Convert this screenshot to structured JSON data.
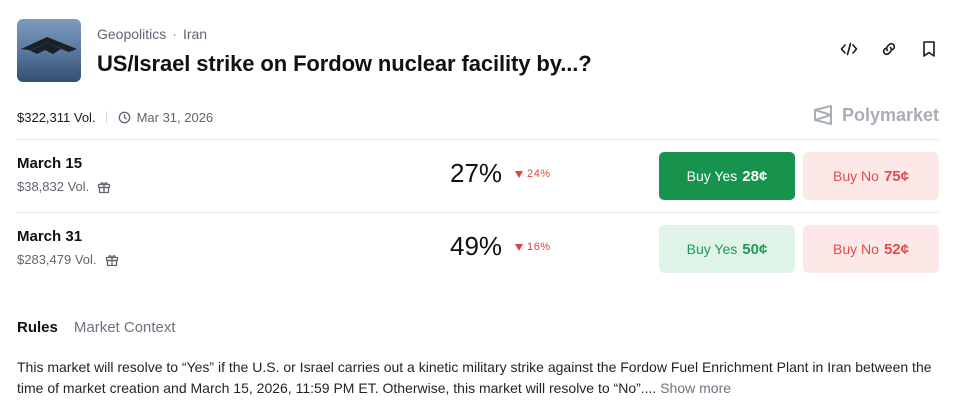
{
  "header": {
    "breadcrumb": [
      "Geopolitics",
      "Iran"
    ],
    "breadcrumb_sep": "·",
    "title": "US/Israel strike on Fordow nuclear facility by...?"
  },
  "meta": {
    "volume": "$322,311 Vol.",
    "end_date": "Mar 31, 2026",
    "brand": "Polymarket"
  },
  "outcomes": [
    {
      "name": "March 15",
      "volume": "$38,832 Vol.",
      "probability": "27%",
      "change": "24%",
      "change_direction": "down",
      "buy_yes_label": "Buy Yes",
      "buy_yes_price": "28¢",
      "buy_no_label": "Buy No",
      "buy_no_price": "75¢"
    },
    {
      "name": "March 31",
      "volume": "$283,479 Vol.",
      "probability": "49%",
      "change": "16%",
      "change_direction": "down",
      "buy_yes_label": "Buy Yes",
      "buy_yes_price": "50¢",
      "buy_no_label": "Buy No",
      "buy_no_price": "52¢"
    }
  ],
  "tabs": [
    "Rules",
    "Market Context"
  ],
  "rules": {
    "text": "This market will resolve to “Yes” if the U.S. or Israel carries out a kinetic military strike against the Fordow Fuel Enrichment Plant in Iran between the time of market creation and March 15, 2026, 11:59 PM ET. Otherwise, this market will resolve to “No”....",
    "show_more": "Show more"
  },
  "colors": {
    "yes_solid": "#17934e",
    "yes_light": "#dff4e7",
    "no_bg": "#fde8e8",
    "no_text": "#e14b4b",
    "down": "#e0443f"
  },
  "icons": {
    "embed": "code-icon",
    "link": "link-icon",
    "bookmark": "bookmark-icon",
    "clock": "clock-icon",
    "gift": "gift-icon",
    "brand": "polymarket-logo-icon",
    "change": "triangle-down-icon"
  }
}
